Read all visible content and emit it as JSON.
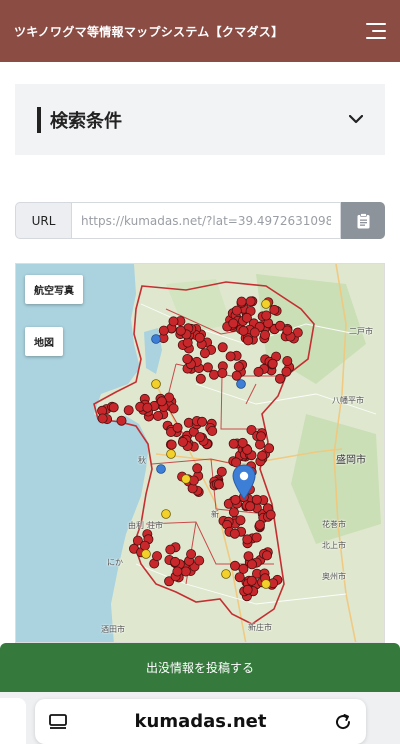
{
  "header": {
    "title": "ツキノワグマ等情報マップシステム【クマダス】"
  },
  "search": {
    "title": "検索条件"
  },
  "url": {
    "label": "URL",
    "value": "https://kumadas.net/?lat=39.4972631098"
  },
  "map": {
    "layers": {
      "aerial": "航空写真",
      "map": "地図"
    },
    "place_labels": {
      "ninohe": "二戸市",
      "hachimantai": "八幡平市",
      "morioka": "盛岡市",
      "hanamaki": "花巻市",
      "kitakami": "北上市",
      "oshu": "奥州市",
      "akita": "秋",
      "yuri": "由利",
      "nikaho": "にか",
      "sakata": "酒田市",
      "shinjo": "新庄市",
      "shin": "新",
      "yurihonjo": "荘市"
    }
  },
  "actions": {
    "post": "出没情報を投稿する"
  },
  "browser": {
    "address": "kumadas.net"
  },
  "colors": {
    "header": "#8b4c44",
    "post_button": "#357a3c",
    "marker": "#c8282b",
    "pin": "#3d7fd6"
  }
}
